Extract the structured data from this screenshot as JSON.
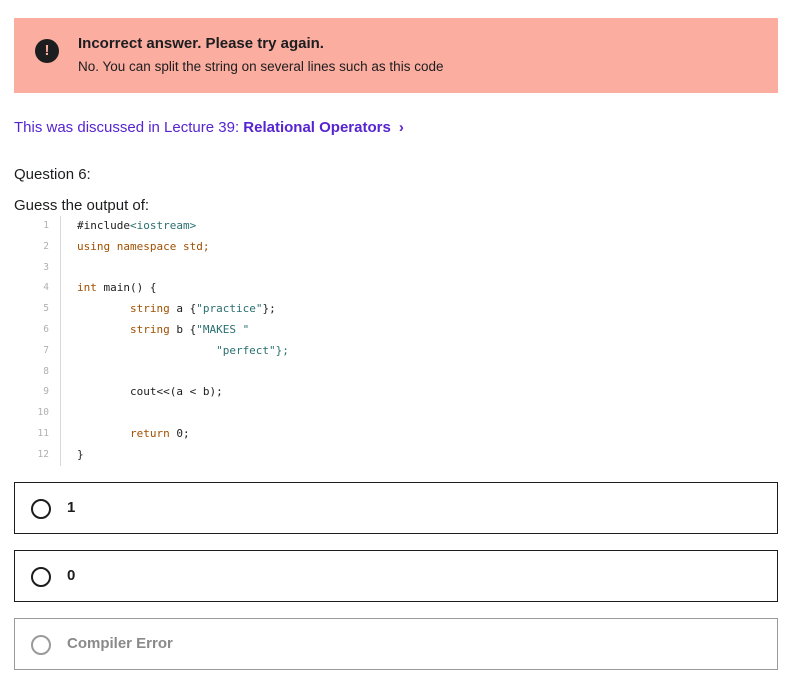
{
  "alert": {
    "title": "Incorrect answer. Please try again.",
    "message": "No. You can split the string on several lines such as this code",
    "icon": "exclamation-icon"
  },
  "lecture": {
    "prefix": "This was discussed in Lecture 39: ",
    "name": "Relational Operators",
    "chevron": "›"
  },
  "question": {
    "number": "Question 6:",
    "prompt": "Guess the output of:"
  },
  "code": [
    {
      "n": "1",
      "text": "#include<iostream>"
    },
    {
      "n": "2",
      "text": "using namespace std;"
    },
    {
      "n": "3",
      "text": ""
    },
    {
      "n": "4",
      "text": "int main() {"
    },
    {
      "n": "5",
      "text": "        string a {\"practice\"};"
    },
    {
      "n": "6",
      "text": "        string b {\"MAKES \""
    },
    {
      "n": "7",
      "text": "                     \"perfect\"};"
    },
    {
      "n": "8",
      "text": ""
    },
    {
      "n": "9",
      "text": "        cout<<(a < b);"
    },
    {
      "n": "10",
      "text": ""
    },
    {
      "n": "11",
      "text": "        return 0;"
    },
    {
      "n": "12",
      "text": "}"
    }
  ],
  "options": [
    {
      "label": "1",
      "disabled": false
    },
    {
      "label": "0",
      "disabled": false
    },
    {
      "label": "Compiler Error",
      "disabled": true
    }
  ],
  "colors": {
    "alert_bg": "#fbada0",
    "link": "#5624d0",
    "keyword": "#a04f00",
    "string": "#2a6f70"
  }
}
